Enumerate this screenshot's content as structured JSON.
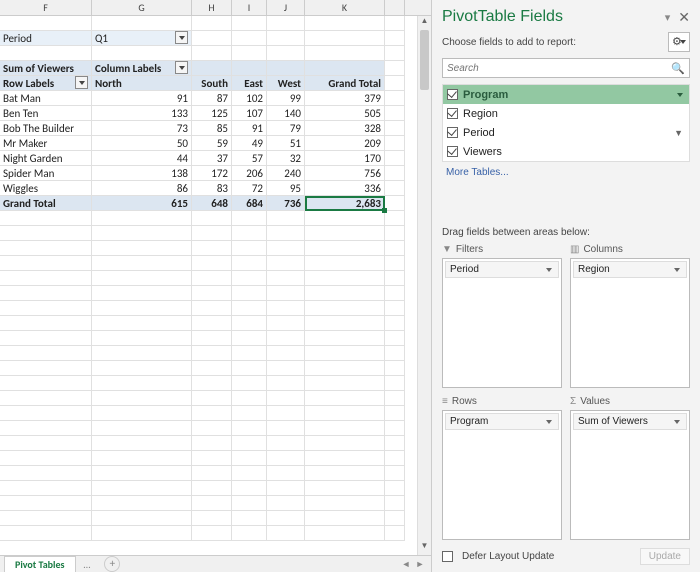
{
  "columns": [
    "F",
    "G",
    "H",
    "I",
    "J",
    "K"
  ],
  "filter": {
    "label": "Period",
    "value": "Q1"
  },
  "pivot": {
    "measure_label": "Sum of Viewers",
    "col_labels_text": "Column Labels",
    "row_labels_text": "Row Labels",
    "col_headers": [
      "North",
      "South",
      "East",
      "West",
      "Grand Total"
    ],
    "rows": [
      {
        "label": "Bat Man",
        "vals": [
          91,
          87,
          102,
          99,
          379
        ]
      },
      {
        "label": "Ben Ten",
        "vals": [
          133,
          125,
          107,
          140,
          505
        ]
      },
      {
        "label": "Bob The Builder",
        "vals": [
          73,
          85,
          91,
          79,
          328
        ]
      },
      {
        "label": "Mr Maker",
        "vals": [
          50,
          59,
          49,
          51,
          209
        ]
      },
      {
        "label": "Night Garden",
        "vals": [
          44,
          37,
          57,
          32,
          170
        ]
      },
      {
        "label": "Spider Man",
        "vals": [
          138,
          172,
          206,
          240,
          756
        ]
      },
      {
        "label": "Wiggles",
        "vals": [
          86,
          83,
          72,
          95,
          336
        ]
      }
    ],
    "grand_total": {
      "label": "Grand Total",
      "vals": [
        615,
        648,
        684,
        736,
        "2,683"
      ]
    }
  },
  "sheet_tab": "Pivot Tables",
  "panel": {
    "title": "PivotTable Fields",
    "subtitle": "Choose fields to add to report:",
    "search_placeholder": "Search",
    "fields": [
      {
        "name": "Program",
        "checked": true,
        "selected": true
      },
      {
        "name": "Region",
        "checked": true
      },
      {
        "name": "Period",
        "checked": true,
        "filtered": true
      },
      {
        "name": "Viewers",
        "checked": true
      }
    ],
    "more_tables": "More Tables...",
    "areas_label": "Drag fields between areas below:",
    "areas": {
      "filters": {
        "title": "Filters",
        "items": [
          "Period"
        ]
      },
      "columns": {
        "title": "Columns",
        "items": [
          "Region"
        ]
      },
      "rows": {
        "title": "Rows",
        "items": [
          "Program"
        ]
      },
      "values": {
        "title": "Values",
        "items": [
          "Sum of Viewers"
        ]
      }
    },
    "defer_label": "Defer Layout Update",
    "update_label": "Update"
  },
  "chart_data": {
    "type": "table",
    "title": "Sum of Viewers by Program and Region (Period = Q1)",
    "columns": [
      "Program",
      "North",
      "South",
      "East",
      "West",
      "Grand Total"
    ],
    "rows": [
      [
        "Bat Man",
        91,
        87,
        102,
        99,
        379
      ],
      [
        "Ben Ten",
        133,
        125,
        107,
        140,
        505
      ],
      [
        "Bob The Builder",
        73,
        85,
        91,
        79,
        328
      ],
      [
        "Mr Maker",
        50,
        59,
        49,
        51,
        209
      ],
      [
        "Night Garden",
        44,
        37,
        57,
        32,
        170
      ],
      [
        "Spider Man",
        138,
        172,
        206,
        240,
        756
      ],
      [
        "Wiggles",
        86,
        83,
        72,
        95,
        336
      ],
      [
        "Grand Total",
        615,
        648,
        684,
        736,
        2683
      ]
    ]
  }
}
